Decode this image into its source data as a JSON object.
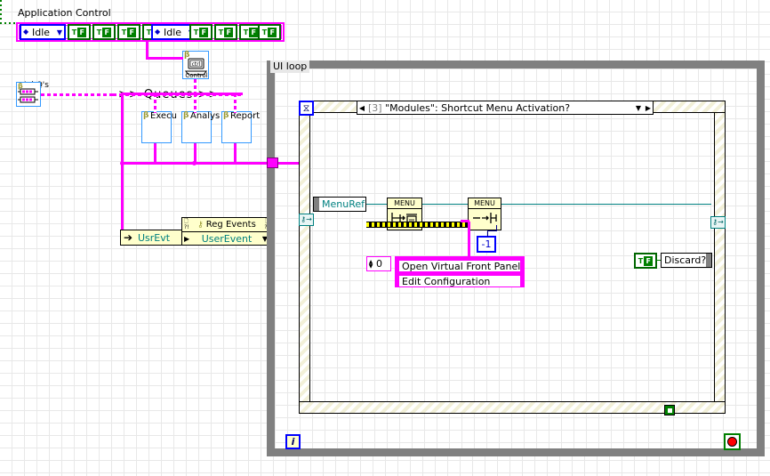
{
  "diagram": {
    "app_control": {
      "title": "Application Control",
      "enum1": {
        "value": "Idle"
      },
      "enum2": {
        "value": "Idle"
      },
      "bool_true": "T",
      "bool_false": "F",
      "bool_count_left": 4,
      "bool_count_right": 4
    },
    "init_queues": {
      "label": "Ini Q's",
      "beta": "β"
    },
    "queues_label": ">> Queues >>",
    "control_vi": {
      "label": "Control",
      "beta": "β",
      "icon": "ctrl"
    },
    "subvis": [
      {
        "label": "Execu",
        "beta": "β",
        "name": "execute-vi"
      },
      {
        "label": "Analys",
        "beta": "β",
        "name": "analysis-vi"
      },
      {
        "label": "Report",
        "beta": "β",
        "name": "report-vi"
      }
    ],
    "user_event_terminal": {
      "label": "UsrEvt"
    },
    "register_events": {
      "title": "Reg Events",
      "item": "UserEvent"
    },
    "ui_loop": {
      "label": "UI loop"
    },
    "event_structure": {
      "case_index": "[3]",
      "case_label": "\"Modules\": Shortcut Menu Activation?",
      "timer_icon": "⧖"
    },
    "menu_ref": {
      "label": "MenuRef"
    },
    "menu_nodes": [
      {
        "header": "MENU",
        "name": "delete-menu-items-node"
      },
      {
        "header": "MENU",
        "name": "insert-menu-items-node"
      }
    ],
    "neg_one_constant": "-1",
    "index_constant": "0",
    "menu_items": [
      "Open Virtual Front Panel",
      "Edit Configuration"
    ],
    "discard": {
      "label": "Discard?",
      "bool_true": "T",
      "bool_false": "F"
    },
    "iteration_terminal": "i",
    "colors": {
      "wire_event": "#ff00ff",
      "wire_refnum": "#008080",
      "wire_error": "#d4d400",
      "loop_border": "#808080",
      "struct_fill": "#f2f0d8",
      "boolean": "#008000",
      "numeric": "#0000ff",
      "stop_red": "#ff0000"
    }
  }
}
